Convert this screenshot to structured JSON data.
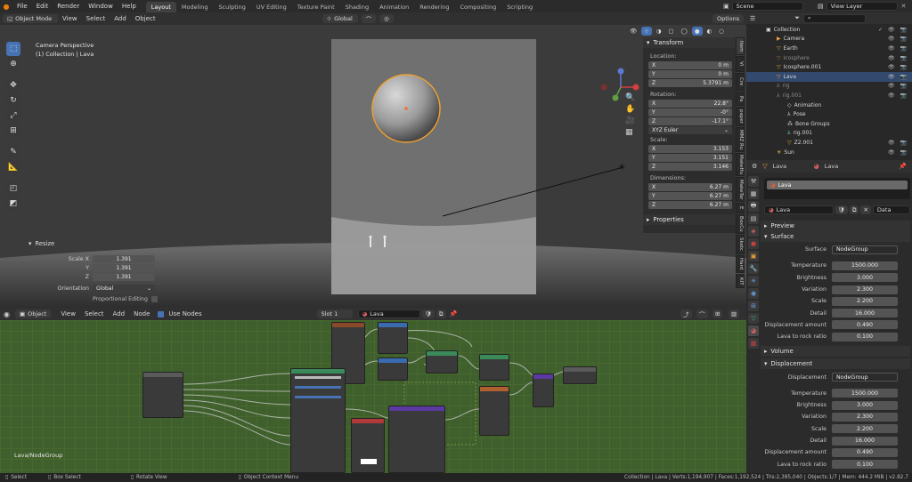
{
  "topbar": {
    "menus": [
      "File",
      "Edit",
      "Render",
      "Window",
      "Help"
    ],
    "workspaces": [
      "Layout",
      "Modeling",
      "Sculpting",
      "UV Editing",
      "Texture Paint",
      "Shading",
      "Animation",
      "Rendering",
      "Compositing",
      "Scripting"
    ],
    "active_workspace": "Layout",
    "scene": "Scene",
    "view_layer": "View Layer"
  },
  "viewport_header": {
    "mode": "Object Mode",
    "menus": [
      "View",
      "Select",
      "Add",
      "Object"
    ],
    "orientation": "Global",
    "options": "Options"
  },
  "viewport": {
    "camera_label": "Camera Perspective",
    "collection_label": "(1) Collection | Lava"
  },
  "resize_panel": {
    "title": "Resize",
    "scale_x_label": "Scale X",
    "scale_x": "1.391",
    "y_label": "Y",
    "scale_y": "1.391",
    "z_label": "Z",
    "scale_z": "1.391",
    "orientation_label": "Orientation",
    "orientation": "Global",
    "proportional": "Proportional Editing"
  },
  "transform_panel": {
    "title": "Transform",
    "location_label": "Location:",
    "location": [
      {
        "axis": "X",
        "value": "0 m"
      },
      {
        "axis": "Y",
        "value": "0 m"
      },
      {
        "axis": "Z",
        "value": "5.3791 m"
      }
    ],
    "rotation_label": "Rotation:",
    "rotation": [
      {
        "axis": "X",
        "value": "22.8°"
      },
      {
        "axis": "Y",
        "value": "-0°"
      },
      {
        "axis": "Z",
        "value": "-17.1°"
      }
    ],
    "euler": "XYZ Euler",
    "scale_label": "Scale:",
    "scale": [
      {
        "axis": "X",
        "value": "3.153"
      },
      {
        "axis": "Y",
        "value": "3.151"
      },
      {
        "axis": "Z",
        "value": "3.146"
      }
    ],
    "dimensions_label": "Dimensions:",
    "dimensions": [
      {
        "axis": "X",
        "value": "6.27 m"
      },
      {
        "axis": "Y",
        "value": "6.27 m"
      },
      {
        "axis": "Z",
        "value": "6.27 m"
      }
    ],
    "properties_title": "Properties",
    "side_tabs": [
      "Vi",
      "Cre",
      "Pa",
      "paper",
      "MMZ Ru",
      "MakeHu",
      "MakeTar",
      "E",
      "BoxCu",
      "Sketc",
      "Hard",
      "KIT"
    ]
  },
  "outliner": {
    "items": [
      {
        "name": "Collection",
        "state": "normal"
      },
      {
        "name": "Camera",
        "state": "normal"
      },
      {
        "name": "Earth",
        "state": "normal"
      },
      {
        "name": "Icosphere",
        "state": "dim"
      },
      {
        "name": "Icosphere.001",
        "state": "normal"
      },
      {
        "name": "Lava",
        "state": "selected"
      },
      {
        "name": "rig",
        "state": "dim"
      },
      {
        "name": "rig.001",
        "state": "dim"
      },
      {
        "name": "Animation",
        "state": "normal"
      },
      {
        "name": "Pose",
        "state": "normal"
      },
      {
        "name": "Bone Groups",
        "state": "normal"
      },
      {
        "name": "rig.001",
        "state": "normal"
      },
      {
        "name": "Z2.001",
        "state": "normal"
      },
      {
        "name": "Sun",
        "state": "normal"
      }
    ]
  },
  "properties": {
    "object_name": "Lava",
    "material_name": "Lava",
    "material_slot": "Lava",
    "data_label": "Data",
    "preview": "Preview",
    "surface_section": "Surface",
    "surface_label": "Surface",
    "surface_value": "NodeGroup",
    "surface_params": [
      {
        "label": "Temperature",
        "value": "1500.000"
      },
      {
        "label": "Brightness",
        "value": "3.000"
      },
      {
        "label": "Variation",
        "value": "2.300"
      },
      {
        "label": "Scale",
        "value": "2.200"
      },
      {
        "label": "Detail",
        "value": "16.000"
      },
      {
        "label": "Displacement amount",
        "value": "0.490"
      },
      {
        "label": "Lava to rock ratio",
        "value": "0.100"
      }
    ],
    "volume_section": "Volume",
    "displacement_section": "Displacement",
    "displacement_label": "Displacement",
    "displacement_value": "NodeGroup",
    "displacement_params": [
      {
        "label": "Temperature",
        "value": "1500.000"
      },
      {
        "label": "Brightness",
        "value": "3.000"
      },
      {
        "label": "Variation",
        "value": "2.300"
      },
      {
        "label": "Scale",
        "value": "2.200"
      },
      {
        "label": "Detail",
        "value": "16.000"
      },
      {
        "label": "Displacement amount",
        "value": "0.490"
      },
      {
        "label": "Lava to rock ratio",
        "value": "0.100"
      }
    ]
  },
  "node_header": {
    "type": "Object",
    "menus": [
      "View",
      "Select",
      "Add",
      "Node"
    ],
    "use_nodes": "Use Nodes",
    "slot": "Slot 1",
    "material": "Lava",
    "breadcrumb": "Lava/NodeGroup"
  },
  "statusbar": {
    "select": "Select",
    "box_select": "Box Select",
    "rotate_view": "Rotate View",
    "context_menu": "Object Context Menu",
    "stats": "Collection | Lava | Verts:1,194,907 | Faces:1,192,524 | Tris:2,385,040 | Objects:1/7 | Mem: 444.2 MiB | v2.82.7"
  },
  "colors": {
    "accent": "#4772b3",
    "selection_outline": "#f0a030",
    "node_bg": "#3f5f2c"
  }
}
